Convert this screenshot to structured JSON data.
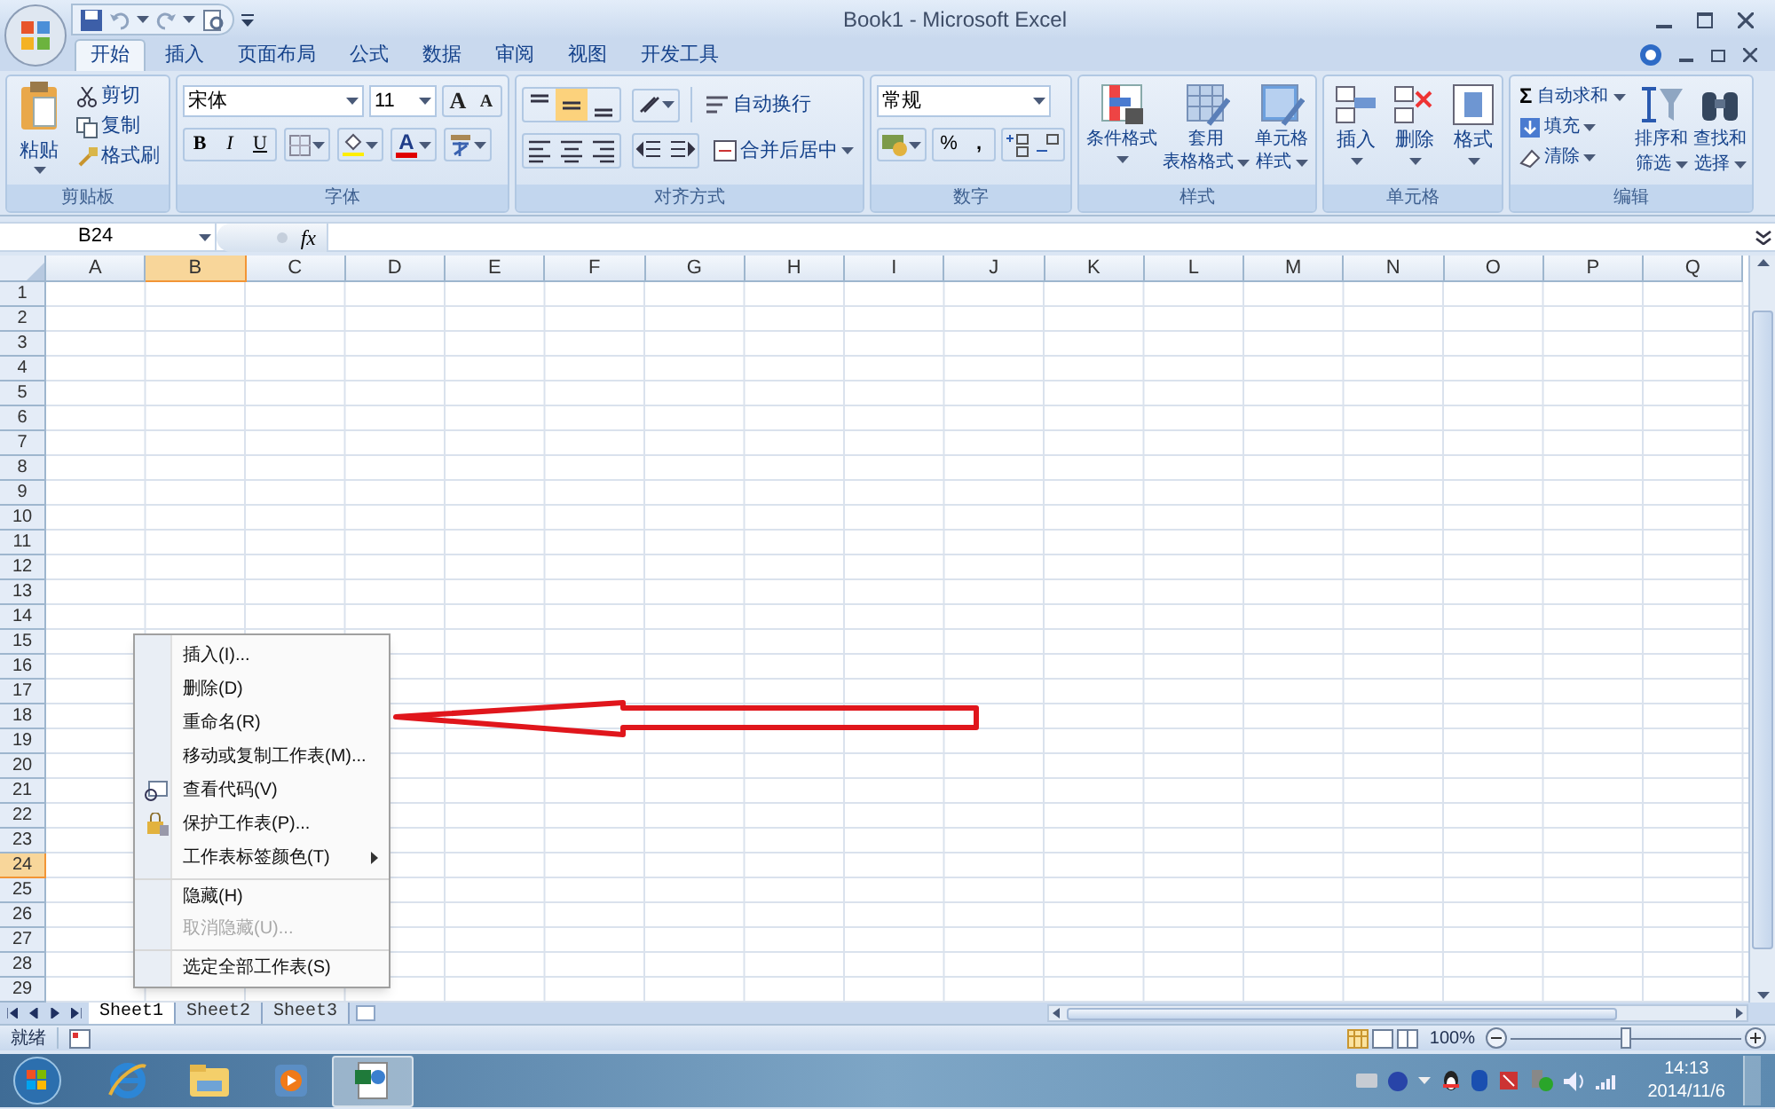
{
  "window": {
    "title": "Book1 - Microsoft Excel"
  },
  "ribbon_tabs": [
    {
      "label": "开始",
      "selected": true
    },
    {
      "label": "插入",
      "selected": false
    },
    {
      "label": "页面布局",
      "selected": false
    },
    {
      "label": "公式",
      "selected": false
    },
    {
      "label": "数据",
      "selected": false
    },
    {
      "label": "审阅",
      "selected": false
    },
    {
      "label": "视图",
      "selected": false
    },
    {
      "label": "开发工具",
      "selected": false
    }
  ],
  "clipboard": {
    "label": "剪贴板",
    "paste": "粘贴",
    "cut": "剪切",
    "copy": "复制",
    "format_painter": "格式刷"
  },
  "font": {
    "label": "字体",
    "font_name": "宋体",
    "font_size": "11",
    "grow": "A",
    "shrink": "A",
    "bold": "B",
    "italic": "I",
    "underline": "U",
    "font_color": "A"
  },
  "alignment": {
    "label": "对齐方式",
    "vertical_align": [
      {
        "selected": false
      },
      {
        "selected": true
      },
      {
        "selected": false
      }
    ],
    "wrap_text": "自动换行",
    "merge_center": "合并后居中"
  },
  "number": {
    "label": "数字",
    "format": "常规",
    "percent": "%",
    "comma": ","
  },
  "styles": {
    "label": "样式",
    "buttons": [
      {
        "lines": [
          "条件格式"
        ]
      },
      {
        "lines": [
          "套用",
          "表格格式"
        ]
      },
      {
        "lines": [
          "单元格",
          "样式"
        ]
      }
    ]
  },
  "cells": {
    "label": "单元格",
    "buttons": [
      "插入",
      "删除",
      "格式"
    ]
  },
  "editing": {
    "label": "编辑",
    "sigma": "Σ",
    "autosum": "自动求和",
    "fill": "填充",
    "clear": "清除",
    "sort": [
      "排序和",
      "筛选"
    ],
    "find": [
      "查找和",
      "选择"
    ]
  },
  "formula_bar": {
    "name_box": "B24",
    "fx": "fx"
  },
  "sheet": {
    "columns": [
      {
        "label": "A",
        "selected": false
      },
      {
        "label": "B",
        "selected": true
      },
      {
        "label": "C",
        "selected": false
      },
      {
        "label": "D",
        "selected": false
      },
      {
        "label": "E",
        "selected": false
      },
      {
        "label": "F",
        "selected": false
      },
      {
        "label": "G",
        "selected": false
      },
      {
        "label": "H",
        "selected": false
      },
      {
        "label": "I",
        "selected": false
      },
      {
        "label": "J",
        "selected": false
      },
      {
        "label": "K",
        "selected": false
      },
      {
        "label": "L",
        "selected": false
      },
      {
        "label": "M",
        "selected": false
      },
      {
        "label": "N",
        "selected": false
      },
      {
        "label": "O",
        "selected": false
      },
      {
        "label": "P",
        "selected": false
      },
      {
        "label": "Q",
        "selected": false
      }
    ],
    "rows": [
      {
        "label": "1",
        "selected": false
      },
      {
        "label": "2",
        "selected": false
      },
      {
        "label": "3",
        "selected": false
      },
      {
        "label": "4",
        "selected": false
      },
      {
        "label": "5",
        "selected": false
      },
      {
        "label": "6",
        "selected": false
      },
      {
        "label": "7",
        "selected": false
      },
      {
        "label": "8",
        "selected": false
      },
      {
        "label": "9",
        "selected": false
      },
      {
        "label": "10",
        "selected": false
      },
      {
        "label": "11",
        "selected": false
      },
      {
        "label": "12",
        "selected": false
      },
      {
        "label": "13",
        "selected": false
      },
      {
        "label": "14",
        "selected": false
      },
      {
        "label": "15",
        "selected": false
      },
      {
        "label": "16",
        "selected": false
      },
      {
        "label": "17",
        "selected": false
      },
      {
        "label": "18",
        "selected": false
      },
      {
        "label": "19",
        "selected": false
      },
      {
        "label": "20",
        "selected": false
      },
      {
        "label": "21",
        "selected": false
      },
      {
        "label": "22",
        "selected": false
      },
      {
        "label": "23",
        "selected": false
      },
      {
        "label": "24",
        "selected": true
      },
      {
        "label": "25",
        "selected": false
      },
      {
        "label": "26",
        "selected": false
      },
      {
        "label": "27",
        "selected": false
      },
      {
        "label": "28",
        "selected": false
      },
      {
        "label": "29",
        "selected": false
      }
    ]
  },
  "context_menu": [
    {
      "label": "插入(I)...",
      "kind": "plain",
      "disabled": false,
      "submenu": false,
      "separator_before": false
    },
    {
      "label": "删除(D)",
      "kind": "plain",
      "disabled": false,
      "submenu": false,
      "separator_before": false
    },
    {
      "label": "重命名(R)",
      "kind": "plain",
      "disabled": false,
      "submenu": false,
      "separator_before": false
    },
    {
      "label": "移动或复制工作表(M)...",
      "kind": "plain",
      "disabled": false,
      "submenu": false,
      "separator_before": false
    },
    {
      "label": "查看代码(V)",
      "kind": "code",
      "disabled": false,
      "submenu": false,
      "separator_before": false
    },
    {
      "label": "保护工作表(P)...",
      "kind": "lock",
      "disabled": false,
      "submenu": false,
      "separator_before": false
    },
    {
      "label": "工作表标签颜色(T)",
      "kind": "plain",
      "disabled": false,
      "submenu": true,
      "separator_before": false
    },
    {
      "label": "隐藏(H)",
      "kind": "plain",
      "disabled": false,
      "submenu": false,
      "separator_before": true
    },
    {
      "label": "取消隐藏(U)...",
      "kind": "plain",
      "disabled": true,
      "submenu": false,
      "separator_before": false
    },
    {
      "label": "选定全部工作表(S)",
      "kind": "plain",
      "disabled": false,
      "submenu": false,
      "separator_before": true
    }
  ],
  "sheet_tabs": [
    {
      "label": "Sheet1",
      "selected": true
    },
    {
      "label": "Sheet2",
      "selected": false
    },
    {
      "label": "Sheet3",
      "selected": false
    }
  ],
  "status_bar": {
    "status": "就绪",
    "zoom": "100%",
    "zoom_slider": {
      "level": 0.5
    }
  },
  "taskbar": {
    "apps": [
      {
        "kind": "ie",
        "selected": false
      },
      {
        "kind": "folder",
        "selected": false
      },
      {
        "kind": "media",
        "selected": false
      },
      {
        "kind": "excel",
        "selected": true
      }
    ],
    "time": "14:13",
    "date": "2014/11/6"
  }
}
